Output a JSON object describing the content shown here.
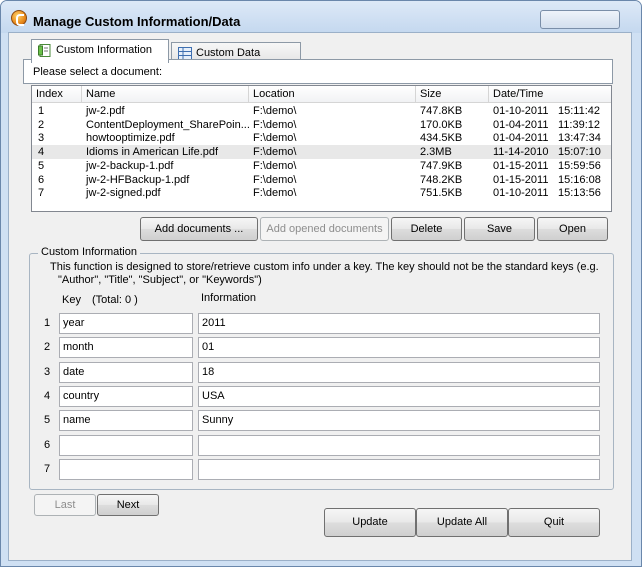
{
  "window": {
    "title": "Manage Custom Information/Data"
  },
  "tabs": [
    {
      "label": "Custom Information",
      "icon": "document-icon"
    },
    {
      "label": "Custom Data",
      "icon": "grid-icon"
    }
  ],
  "documents": {
    "prompt": "Please select a document:",
    "columns": [
      "Index",
      "Name",
      "Location",
      "Size",
      "Date/Time"
    ],
    "rows": [
      {
        "index": "1",
        "name": "jw-2.pdf",
        "location": "F:\\demo\\",
        "size": "747.8KB",
        "date": "01-10-2011",
        "time": "15:11:42"
      },
      {
        "index": "2",
        "name": "ContentDeployment_SharePoin...",
        "location": "F:\\demo\\",
        "size": "170.0KB",
        "date": "01-04-2011",
        "time": "11:39:12"
      },
      {
        "index": "3",
        "name": "howtooptimize.pdf",
        "location": "F:\\demo\\",
        "size": "434.5KB",
        "date": "01-04-2011",
        "time": "13:47:34"
      },
      {
        "index": "4",
        "name": "Idioms in American Life.pdf",
        "location": "F:\\demo\\",
        "size": "2.3MB",
        "date": "11-14-2010",
        "time": "15:07:10"
      },
      {
        "index": "5",
        "name": "jw-2-backup-1.pdf",
        "location": "F:\\demo\\",
        "size": "747.9KB",
        "date": "01-15-2011",
        "time": "15:59:56"
      },
      {
        "index": "6",
        "name": "jw-2-HFBackup-1.pdf",
        "location": "F:\\demo\\",
        "size": "748.2KB",
        "date": "01-15-2011",
        "time": "15:16:08"
      },
      {
        "index": "7",
        "name": "jw-2-signed.pdf",
        "location": "F:\\demo\\",
        "size": "751.5KB",
        "date": "01-10-2011",
        "time": "15:13:56"
      }
    ]
  },
  "doc_buttons": {
    "add": "Add documents ...",
    "add_opened": "Add opened documents",
    "delete": "Delete",
    "save": "Save",
    "open": "Open"
  },
  "custom_info": {
    "legend": "Custom Information",
    "description_line1": "This function is designed to store/retrieve custom info under a key. The key should not be the standard keys (e.g.",
    "description_line2": "\"Author\", \"Title\", \"Subject\", or \"Keywords\")",
    "key_header": "Key",
    "total_label": "(Total: 0 )",
    "info_header": "Information",
    "entries": [
      {
        "num": "1",
        "key": "year",
        "value": "2011"
      },
      {
        "num": "2",
        "key": "month",
        "value": "01"
      },
      {
        "num": "3",
        "key": "date",
        "value": "18"
      },
      {
        "num": "4",
        "key": "country",
        "value": "USA"
      },
      {
        "num": "5",
        "key": "name",
        "value": "Sunny"
      },
      {
        "num": "6",
        "key": "",
        "value": ""
      },
      {
        "num": "7",
        "key": "",
        "value": ""
      }
    ]
  },
  "nav_buttons": {
    "last": "Last",
    "next": "Next"
  },
  "footer_buttons": {
    "update": "Update",
    "update_all": "Update All",
    "quit": "Quit"
  }
}
